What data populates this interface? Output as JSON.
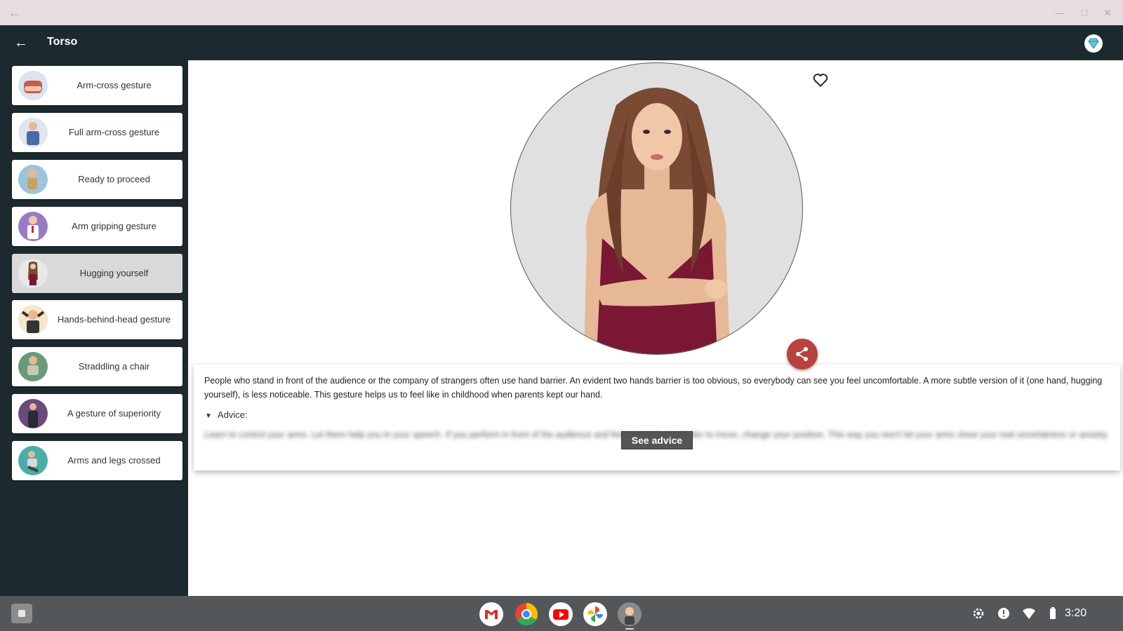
{
  "window": {
    "back_icon": "arrow-left-icon",
    "controls": [
      "minimize-icon",
      "maximize-icon",
      "close-icon"
    ]
  },
  "appbar": {
    "title": "Torso",
    "back_icon": "arrow-left-icon",
    "premium_icon": "diamond-icon"
  },
  "sidebar": {
    "items": [
      {
        "label": "Arm-cross gesture"
      },
      {
        "label": "Full arm-cross gesture"
      },
      {
        "label": "Ready to proceed"
      },
      {
        "label": "Arm gripping gesture"
      },
      {
        "label": "Hugging yourself",
        "selected": true
      },
      {
        "label": "Hands-behind-head gesture"
      },
      {
        "label": "Straddling a chair"
      },
      {
        "label": "A gesture of superiority"
      },
      {
        "label": "Arms and legs crossed"
      }
    ]
  },
  "detail": {
    "description": "People who stand in front of the audience or the company of strangers often use hand barrier. An evident two hands barrier is too obvious, so everybody can see you feel uncomfortable. A more subtle version of it (one hand, hugging yourself), is less noticeable. This gesture helps us to feel like in childhood when parents kept our hand.",
    "advice_label": "Advice:",
    "advice_text": "Learn to control your arms. Let them help you in your speech. If you perform in front of the audience and feel stressed, it is better to move, change your position. This way you won't let your arms show your real uncertainess or anxiety.",
    "see_advice_button": "See advice",
    "favorite_icon": "heart-outline-icon",
    "share_icon": "share-icon"
  },
  "taskbar": {
    "launcher_icon": "launcher-icon",
    "apps": [
      "gmail-icon",
      "chrome-icon",
      "youtube-icon",
      "photos-icon",
      "body-language-app-icon"
    ],
    "tray": [
      "settings-icon",
      "notification-icon",
      "wifi-icon",
      "battery-icon"
    ],
    "time": "3:20"
  },
  "colors": {
    "appbar": "#1c2a30",
    "share_fab": "#b8423d",
    "dress": "#7a1834",
    "hair": "#7a4a32"
  }
}
